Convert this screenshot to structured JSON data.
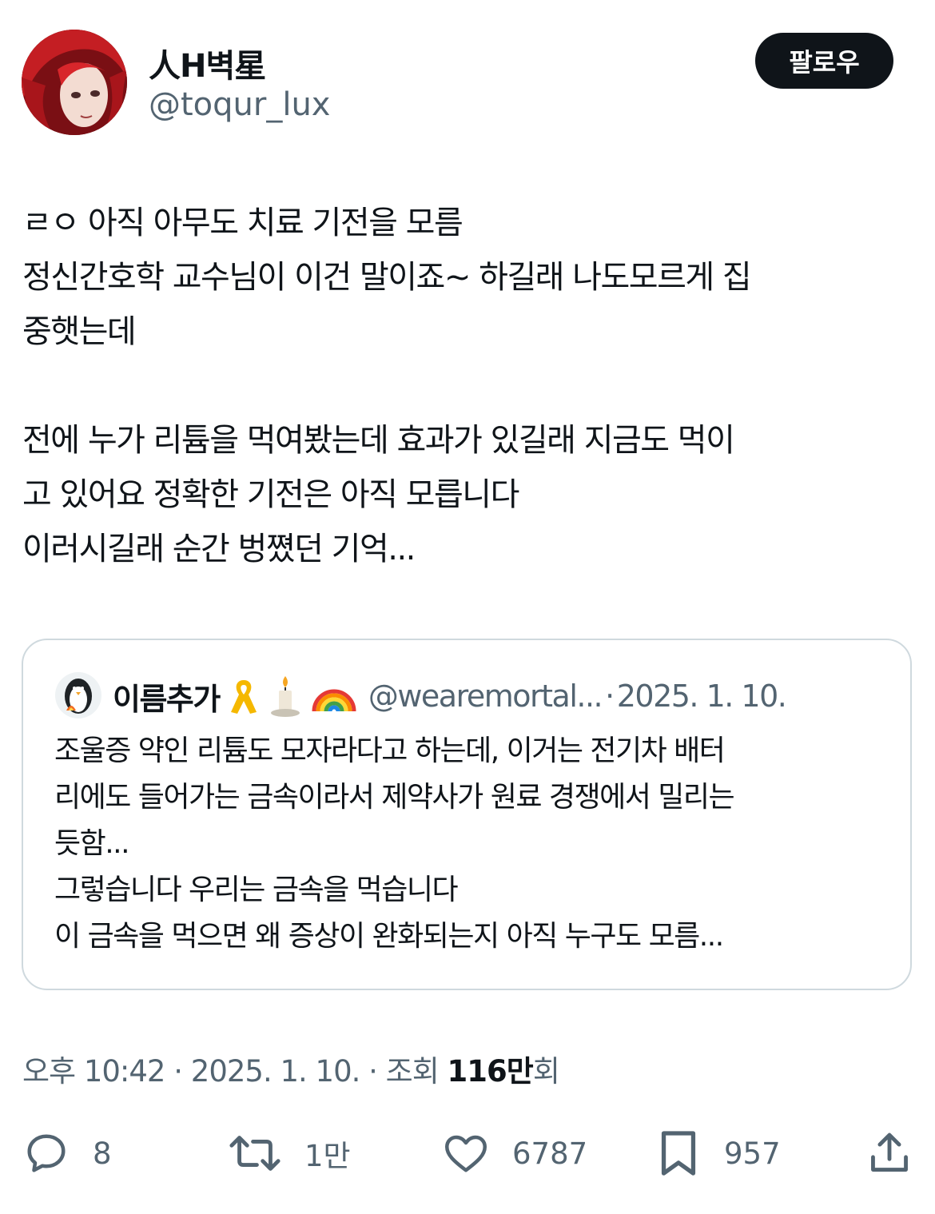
{
  "author": {
    "display_name": "人H벽星",
    "handle": "@toqur_lux"
  },
  "follow_button": {
    "label": "팔로우"
  },
  "tweet": {
    "paragraphs": [
      [
        "ㄹㅇ 아직 아무도 치료 기전을 모름",
        "정신간호학 교수님이 이건 말이죠~ 하길래 나도모르게 집",
        "중햇는데"
      ],
      [
        "전에 누가 리튬을 먹여봤는데 효과가 있길래 지금도 먹이",
        "고 있어요 정확한 기전은 아직 모릅니다",
        "이러시길래 순간 벙쪘던 기억..."
      ]
    ]
  },
  "quote": {
    "name": "이름추가",
    "emoji_icons": [
      "ribbon-icon",
      "candle-icon",
      "rainbow-icon"
    ],
    "handle": "@wearemortal...",
    "separator": "·",
    "date": "2025. 1. 10.",
    "lines": [
      "조울증 약인 리튬도 모자라다고 하는데, 이거는 전기차 배터",
      "리에도 들어가는 금속이라서 제약사가 원료 경쟁에서 밀리는",
      "듯함...",
      "그렇습니다 우리는 금속을 먹습니다",
      "이 금속을 먹으면 왜 증상이 완화되는지 아직 누구도 모름..."
    ]
  },
  "meta": {
    "time": "오후 10:42",
    "date": "2025. 1. 10.",
    "separator": "·",
    "views_prefix": "조회",
    "views_count": "116만",
    "views_suffix": "회"
  },
  "actions": {
    "reply_count": "8",
    "retweet_count": "1만",
    "like_count": "6787",
    "bookmark_count": "957"
  },
  "colors": {
    "text": "#0f1419",
    "muted": "#536471",
    "border": "#cfd9de",
    "avatar_hair": "#c41e23"
  }
}
